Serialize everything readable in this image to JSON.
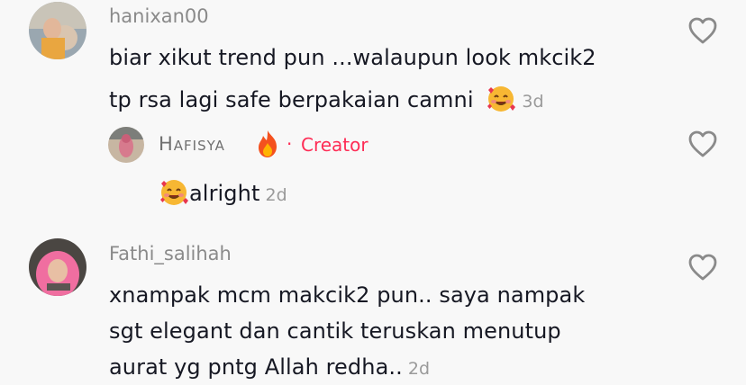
{
  "comments": [
    {
      "username": "hanixan00",
      "lines": [
        "biar xikut trend pun ...walaupun look mkcik2",
        "tp rsa lagi safe berpakaian camni"
      ],
      "time": "3d",
      "trailing_emoji": "smiling-face-with-hearts",
      "replies": [
        {
          "username": "Hafisya",
          "name_emoji": "fire",
          "badge": "Creator",
          "text": "alright",
          "leading_emoji": "smiling-face-with-hearts",
          "time": "2d"
        }
      ]
    },
    {
      "username": "Fathi_salihah",
      "lines": [
        "xnampak mcm makcik2 pun.. saya nampak",
        "sgt elegant dan cantik teruskan menutup",
        "aurat yg pntg Allah redha.."
      ],
      "time": "2d"
    }
  ],
  "icons": {
    "like": "heart-outline-icon"
  },
  "colors": {
    "background": "#f8f8f8",
    "text": "#161823",
    "username": "#8a8a8a",
    "creator": "#fe2c55"
  }
}
